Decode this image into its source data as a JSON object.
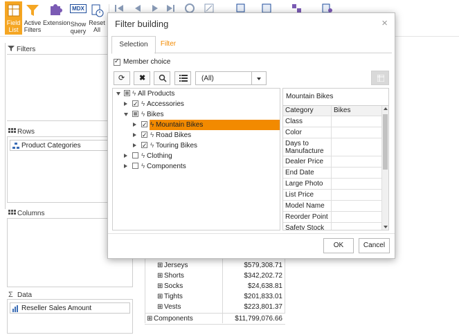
{
  "toolbar": {
    "field_list": "Field List",
    "active_filters": "Active Filters",
    "extension": "Extension",
    "show_query": "Show query",
    "reset_all": "Reset All",
    "mdx_badge": "MDX"
  },
  "left_panel": {
    "filters_title": "Filters",
    "rows_title": "Rows",
    "rows_item": "Product Categories",
    "columns_title": "Columns",
    "data_title": "Data",
    "data_item": "Reseller Sales Amount"
  },
  "grid": {
    "rows": [
      {
        "label": "Jerseys",
        "value": "$579,308.71"
      },
      {
        "label": "Shorts",
        "value": "$342,202.72"
      },
      {
        "label": "Socks",
        "value": "$24,638.81"
      },
      {
        "label": "Tights",
        "value": "$201,833.01"
      },
      {
        "label": "Vests",
        "value": "$223,801.37"
      }
    ],
    "total": {
      "label": "Components",
      "value": "$11,799,076.66"
    }
  },
  "dialog": {
    "title": "Filter building",
    "close_glyph": "×",
    "tab_selection": "Selection",
    "tab_filter": "Filter",
    "member_choice": "Member choice",
    "level_select": "(All)",
    "tree": {
      "all_products": "All Products",
      "accessories": "Accessories",
      "bikes": "Bikes",
      "mountain_bikes": "Mountain Bikes",
      "road_bikes": "Road Bikes",
      "touring_bikes": "Touring Bikes",
      "clothing": "Clothing",
      "components": "Components"
    },
    "props": {
      "title": "Mountain Bikes",
      "col_category": "Category",
      "col_bikes": "Bikes",
      "rows": [
        "Class",
        "Color",
        "Days to Manufacture",
        "Dealer Price",
        "End Date",
        "Large Photo",
        "List Price",
        "Model Name",
        "Reorder Point",
        "Safety Stock"
      ]
    },
    "ok": "OK",
    "cancel": "Cancel"
  },
  "colors": {
    "accent": "#f5a623",
    "selected_row": "#f28a00",
    "tab_active_text": "#333333",
    "tab_inactive_text": "#f28a00"
  }
}
